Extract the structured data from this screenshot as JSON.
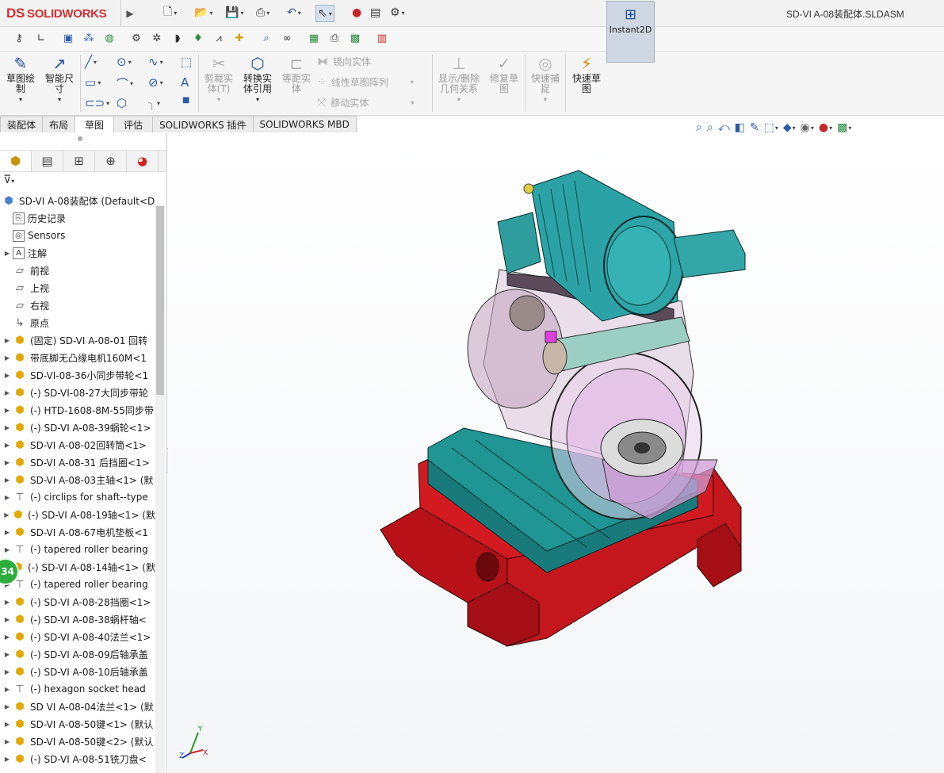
{
  "app": {
    "logo_text": "SOLIDWORKS",
    "logo_mark": "DS",
    "document_title": "SD-VI A-08装配体.SLDASM"
  },
  "quick_access": [
    "new-icon",
    "open-icon",
    "save-icon",
    "print-icon",
    "undo-icon",
    "select-icon",
    "rebuild-icon",
    "file-properties-icon",
    "options-icon"
  ],
  "command_manager": {
    "sketch": "草图绘\n制",
    "smart_dimension": "智能尺\n寸",
    "trim": "剪裁实\n体(T)",
    "convert": "转换实\n体引用",
    "offset": "等距实\n体",
    "mirror": "镜向实体",
    "linear_pattern": "线性草图阵列",
    "move": "移动实体",
    "display_relations": "显示/删除\n几何关系",
    "repair": "修复草\n图",
    "quick_snaps": "快速捕\n捉",
    "rapid_sketch": "快速草\n图",
    "instant2d": "Instant2D"
  },
  "tabs": [
    "装配体",
    "布局",
    "草图",
    "评估",
    "SOLIDWORKS 插件",
    "SOLIDWORKS MBD"
  ],
  "active_tab": "草图",
  "tree": {
    "root": "SD-VI A-08装配体  (Default<D",
    "items": [
      {
        "label": "历史记录",
        "icon": "history-icon",
        "expand": false
      },
      {
        "label": "Sensors",
        "icon": "sensors-icon",
        "expand": false
      },
      {
        "label": "注解",
        "icon": "annotations-icon",
        "expand": true
      },
      {
        "label": "前视",
        "icon": "plane-icon",
        "expand": false
      },
      {
        "label": "上视",
        "icon": "plane-icon",
        "expand": false
      },
      {
        "label": "右视",
        "icon": "plane-icon",
        "expand": false
      },
      {
        "label": "原点",
        "icon": "origin-icon",
        "expand": false
      },
      {
        "label": "(固定) SD-VI A-08-01 回转",
        "icon": "part-icon",
        "expand": true
      },
      {
        "label": "带底脚无凸缘电机160M<1",
        "icon": "part-icon",
        "expand": true
      },
      {
        "label": "SD-VI-08-36小同步带轮<1",
        "icon": "part-icon",
        "expand": true
      },
      {
        "label": "(-) SD-VI-08-27大同步带轮",
        "icon": "part-icon",
        "expand": true
      },
      {
        "label": "(-) HTD-1608-8M-55同步带",
        "icon": "part-icon",
        "expand": true
      },
      {
        "label": "(-) SD-VI A-08-39蜗轮<1>",
        "icon": "part-icon",
        "expand": true
      },
      {
        "label": "SD-VI A-08-02回转筒<1>",
        "icon": "part-icon",
        "expand": true
      },
      {
        "label": "SD-VI A-08-31 后挡圈<1>",
        "icon": "part-icon",
        "expand": true
      },
      {
        "label": "SD-VI A-08-03主轴<1> (默",
        "icon": "part-icon",
        "expand": true
      },
      {
        "label": "(-) circlips for shaft--type",
        "icon": "bolt-icon",
        "expand": true
      },
      {
        "label": "(-) SD-VI A-08-19轴<1> (默",
        "icon": "part-icon",
        "expand": true
      },
      {
        "label": "SD-VI A-08-67电机垫板<1",
        "icon": "part-icon",
        "expand": true
      },
      {
        "label": "(-) tapered roller bearing",
        "icon": "bolt-icon",
        "expand": true
      },
      {
        "label": "(-) SD-VI A-08-14轴<1> (默",
        "icon": "part-icon",
        "expand": true
      },
      {
        "label": "(-) tapered roller bearing",
        "icon": "bolt-icon",
        "expand": true
      },
      {
        "label": "(-) SD-VI A-08-28挡圈<1>",
        "icon": "part-icon",
        "expand": true
      },
      {
        "label": "(-) SD-VI A-08-38蜗杆轴<",
        "icon": "part-icon",
        "expand": true
      },
      {
        "label": "(-) SD-VI A-08-40法兰<1>",
        "icon": "part-icon",
        "expand": true
      },
      {
        "label": "(-) SD-VI A-08-09后轴承盖",
        "icon": "part-icon",
        "expand": true
      },
      {
        "label": "(-) SD-VI A-08-10后轴承盖",
        "icon": "part-icon",
        "expand": true
      },
      {
        "label": "(-) hexagon socket head",
        "icon": "bolt-icon",
        "expand": true
      },
      {
        "label": "SD VI A-08-04法兰<1> (默",
        "icon": "part-icon",
        "expand": true
      },
      {
        "label": "SD-VI A-08-50键<1> (默认",
        "icon": "part-icon",
        "expand": true
      },
      {
        "label": "SD-VI A-08-50键<2> (默认",
        "icon": "part-icon",
        "expand": true
      },
      {
        "label": "(-) SD-VI A-08-51铣刀盘<",
        "icon": "part-icon",
        "expand": true
      }
    ]
  },
  "badge": "34",
  "triad": {
    "x": "X",
    "y": "Y",
    "z": "Z"
  },
  "colors": {
    "base": "#c0141c",
    "table": "#1c8c8c",
    "motor": "#2a9a9e",
    "housing": "#c8a2c8"
  }
}
